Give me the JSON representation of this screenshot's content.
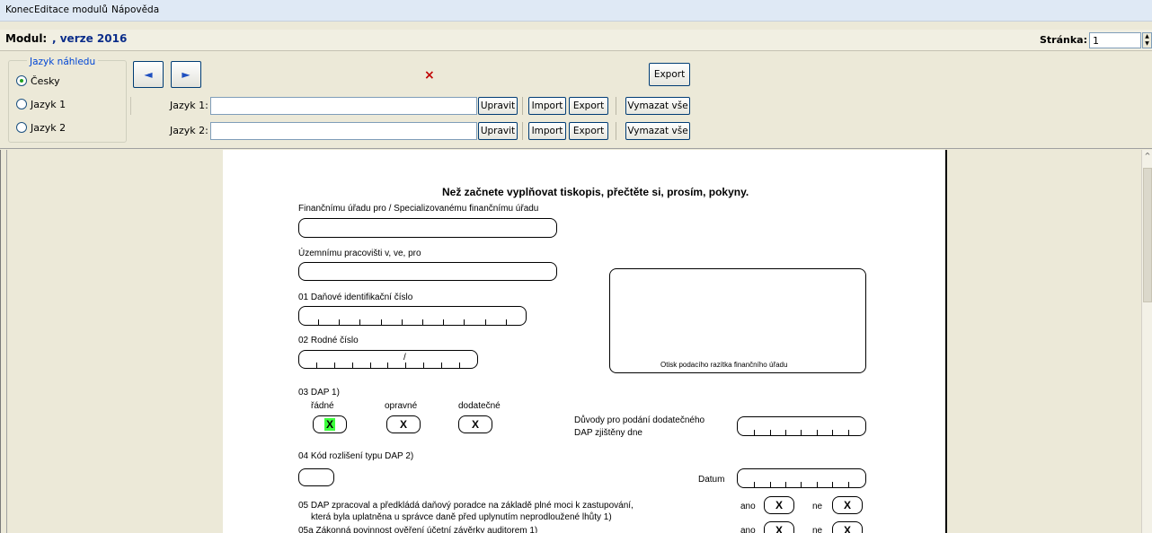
{
  "menu": {
    "items": [
      "Konec",
      "Editace modulů",
      "Nápověda"
    ]
  },
  "module": {
    "label": "Modul:",
    "value": ", verze 2016",
    "page_label": "Stránka:",
    "page_value": "1"
  },
  "preview_language": {
    "title": "Jazyk náhledu",
    "options": [
      "Česky",
      "Jazyk 1",
      "Jazyk 2"
    ],
    "selected": "Česky"
  },
  "toolbar": {
    "prev_icon": "triangle-left-icon",
    "next_icon": "triangle-right-icon",
    "close_mark": "×",
    "export_label": "Export"
  },
  "lang_rows": [
    {
      "label": "Jazyk 1:",
      "value": "",
      "edit": "Upravit",
      "import": "Import",
      "export": "Export",
      "clear": "Vymazat vše"
    },
    {
      "label": "Jazyk 2:",
      "value": "",
      "edit": "Upravit",
      "import": "Import",
      "export": "Export",
      "clear": "Vymazat vše"
    }
  ],
  "form": {
    "title": "Než začnete vyplňovat tiskopis, přečtěte si, prosím, pokyny.",
    "office_label": "Finančnímu úřadu pro / Specializovanému finančnímu úřadu",
    "territorial_label": "Územnímu pracovišti v, ve, pro",
    "stamp_label": "Otisk podacího razítka finančního úřadu",
    "dic_label": "01 Daňové identifikační číslo",
    "rc_label": "02 Rodné číslo",
    "rc_slash": "/",
    "dap_label": "03 DAP 1)",
    "dap_types": [
      "řádné",
      "opravné",
      "dodatečné"
    ],
    "dap_marks": [
      "X",
      "X",
      "X"
    ],
    "reasons_label_1": "Důvody pro podání dodatečného",
    "reasons_label_2": "DAP zjištěny dne",
    "code_label": "04 Kód rozlišení typu DAP 2)",
    "date_label": "Datum",
    "advisor_line_1": "05 DAP zpracoval a předkládá daňový poradce na základě plné moci k zastupování,",
    "advisor_line_2": "která byla uplatněna u správce daně před uplynutím neprodloužené lhůty 1)",
    "audit_line": "05a Zákonná povinnost ověření účetní závěrky auditorem 1)",
    "yes": "ano",
    "no": "ne",
    "mark": "X"
  }
}
